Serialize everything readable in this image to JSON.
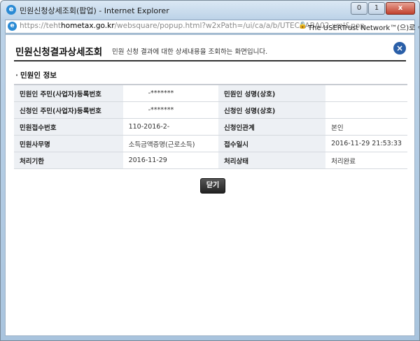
{
  "window": {
    "title": "민원신청상세조회(팝업) - Internet Explorer",
    "url_scheme": "https://teht",
    "url_host": "hometax.go.kr",
    "url_path": "/websquare/popup.html?w2xPath=/ui/ca/a/b/UTECAABA02.xml&pop",
    "cert_text": "The USERTrust Network™(으)로 식별됨",
    "min_btn": "0",
    "max_btn": "1",
    "close_btn": "x"
  },
  "popup": {
    "title": "민원신청결과상세조회",
    "description": "민원 신청 결과에 대한 상세내용을 조회하는 화면입니다.",
    "close_icon": "×"
  },
  "section": {
    "title": "민원인 정보"
  },
  "table": {
    "rows": [
      {
        "l1": "민원인 주민(사업자)등록번호",
        "v1": "-*******",
        "l2": "민원인 성명(상호)",
        "v2": ""
      },
      {
        "l1": "신청인 주민(사업자)등록번호",
        "v1": "-*******",
        "l2": "신청인 성명(상호)",
        "v2": ""
      },
      {
        "l1": "민원접수번호",
        "v1": "110-2016-2-",
        "l2": "신청인관계",
        "v2": "본인"
      },
      {
        "l1": "민원사무명",
        "v1": "소득금액증명(근로소득)",
        "l2": "접수일시",
        "v2": "2016-11-29 21:53:33"
      },
      {
        "l1": "처리기한",
        "v1": "2016-11-29",
        "l2": "처리상태",
        "v2": "처리완료"
      }
    ]
  },
  "buttons": {
    "close_label": "닫기"
  }
}
